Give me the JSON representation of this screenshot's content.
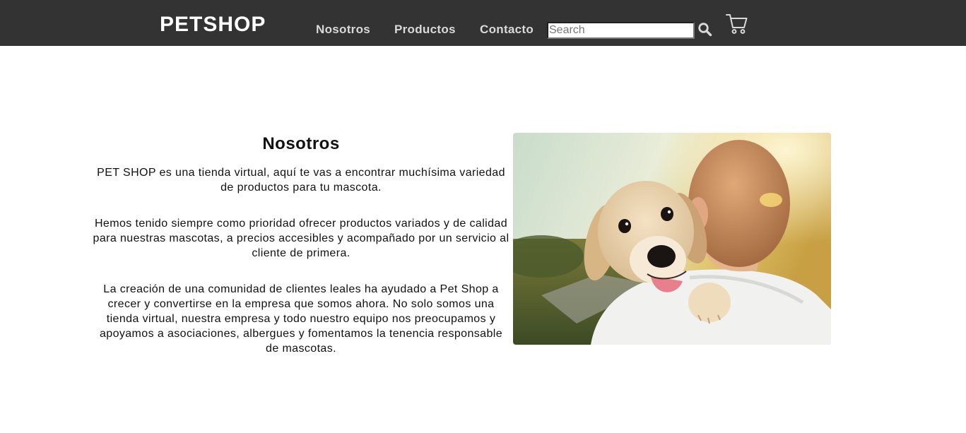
{
  "nav": {
    "brand": "PETSHOP",
    "links": [
      "Nosotros",
      "Productos",
      "Contacto"
    ],
    "search_placeholder": "Search",
    "search_icon": "search-icon",
    "cart_icon": "cart-icon"
  },
  "about": {
    "title": "Nosotros",
    "paragraphs": [
      "PET SHOP es una tienda virtual, aquí te vas a encontrar muchísima variedad de productos para tu mascota.",
      "Hemos tenido siempre como prioridad ofrecer productos variados y de calidad para nuestras mascotas, a precios accesibles y acompañado por un servicio al cliente de primera.",
      "La creación de una comunidad de clientes leales ha ayudado a Pet Shop a crecer y convertirse en la empresa que somos ahora. No solo somos una tienda virtual, nuestra empresa y todo nuestro equipo nos preocupamos y apoyamos a asociaciones, albergues y fomentamos la tenencia responsable de mascotas."
    ]
  },
  "colors": {
    "navbar_bg": "#333333",
    "brand": "#ffffff",
    "nav_link": "#d9d9d9"
  }
}
